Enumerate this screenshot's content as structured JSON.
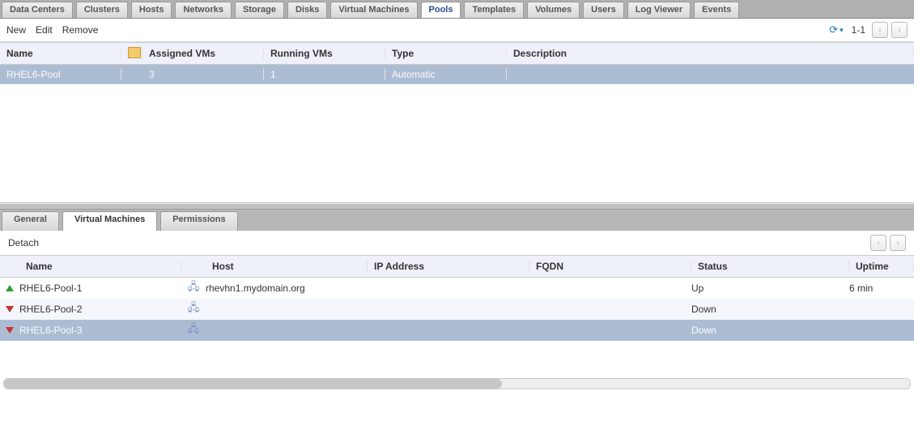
{
  "topTabs": [
    {
      "label": "Data Centers"
    },
    {
      "label": "Clusters"
    },
    {
      "label": "Hosts"
    },
    {
      "label": "Networks"
    },
    {
      "label": "Storage"
    },
    {
      "label": "Disks"
    },
    {
      "label": "Virtual Machines"
    },
    {
      "label": "Pools",
      "active": true
    },
    {
      "label": "Templates"
    },
    {
      "label": "Volumes"
    },
    {
      "label": "Users"
    },
    {
      "label": "Log Viewer"
    },
    {
      "label": "Events"
    }
  ],
  "mainToolbar": {
    "new": "New",
    "edit": "Edit",
    "remove": "Remove",
    "pageRange": "1-1"
  },
  "mainGrid": {
    "headers": {
      "name": "Name",
      "assigned": "Assigned VMs",
      "running": "Running VMs",
      "type": "Type",
      "description": "Description"
    },
    "rows": [
      {
        "name": "RHEL6-Pool",
        "assigned": "3",
        "running": "1",
        "type": "Automatic",
        "description": "",
        "selected": true
      }
    ]
  },
  "subTabs": [
    {
      "label": "General"
    },
    {
      "label": "Virtual Machines",
      "active": true
    },
    {
      "label": "Permissions"
    }
  ],
  "subToolbar": {
    "detach": "Detach"
  },
  "vmGrid": {
    "headers": {
      "name": "Name",
      "host": "Host",
      "ip": "IP Address",
      "fqdn": "FQDN",
      "status": "Status",
      "uptime": "Uptime"
    },
    "rows": [
      {
        "name": "RHEL6-Pool-1",
        "host": "rhevhn1.mydomain.org",
        "ip": "",
        "fqdn": "",
        "status": "Up",
        "uptime": "6 min",
        "state": "up"
      },
      {
        "name": "RHEL6-Pool-2",
        "host": "",
        "ip": "",
        "fqdn": "",
        "status": "Down",
        "uptime": "",
        "state": "down"
      },
      {
        "name": "RHEL6-Pool-3",
        "host": "",
        "ip": "",
        "fqdn": "",
        "status": "Down",
        "uptime": "",
        "state": "down",
        "selected": true
      }
    ]
  }
}
